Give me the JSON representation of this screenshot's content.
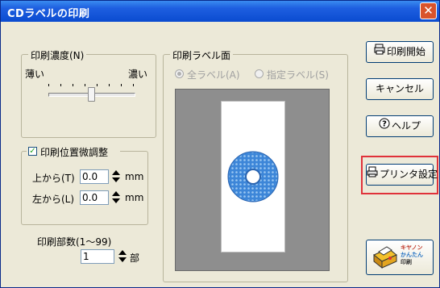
{
  "window": {
    "title": "CDラベルの印刷",
    "close_label": "✕"
  },
  "density": {
    "legend": "印刷濃度(N)",
    "min_label": "薄い",
    "max_label": "濃い",
    "level": 0.5
  },
  "fine_adjust": {
    "legend": "印刷位置微調整",
    "checked": true,
    "top_label": "上から(T)",
    "top_value": "0.0",
    "left_label": "左から(L)",
    "left_value": "0.0",
    "unit": "mm"
  },
  "copies": {
    "label": "印刷部数(1〜99)",
    "value": "1",
    "unit": "部"
  },
  "label_side": {
    "legend": "印刷ラベル面",
    "option_all": "全ラベル(A)",
    "option_selected": "指定ラベル(S)",
    "selected": "all"
  },
  "buttons": {
    "start": "印刷開始",
    "cancel": "キャンセル",
    "help": "ヘルプ",
    "printer_settings": "プリンタ設定",
    "logo_text": "キヤノン かんたん 印刷"
  },
  "colors": {
    "title_bar": "#1e5fe0",
    "highlight": "#e0323a",
    "disc": "#3d86d8"
  }
}
